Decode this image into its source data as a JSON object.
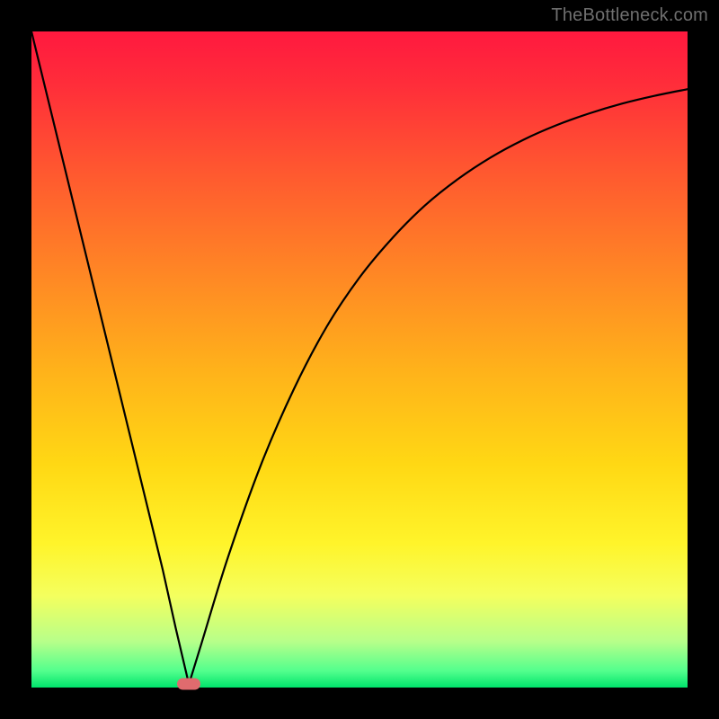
{
  "watermark": "TheBottleneck.com",
  "chart_data": {
    "type": "line",
    "title": "",
    "xlabel": "",
    "ylabel": "",
    "xlim": [
      0,
      100
    ],
    "ylim": [
      0,
      100
    ],
    "grid": false,
    "legend": false,
    "background_gradient": {
      "top": "#ff193f",
      "bottom": "#00e36b",
      "stops": [
        "red",
        "orange",
        "yellow",
        "green"
      ]
    },
    "series": [
      {
        "name": "left-branch",
        "x": [
          0,
          5,
          10,
          15,
          20,
          22,
          24
        ],
        "y": [
          100,
          79.5,
          59,
          38.5,
          18,
          9,
          0.5
        ]
      },
      {
        "name": "right-branch",
        "x": [
          24,
          26,
          30,
          35,
          40,
          45,
          50,
          55,
          60,
          65,
          70,
          75,
          80,
          85,
          90,
          95,
          100
        ],
        "y": [
          0.5,
          7,
          20,
          34,
          45.5,
          55,
          62.5,
          68.5,
          73.5,
          77.5,
          80.8,
          83.5,
          85.7,
          87.5,
          89,
          90.2,
          91.2
        ]
      }
    ],
    "marker": {
      "x": 24,
      "y": 0.6,
      "color": "#e06b6e"
    }
  }
}
